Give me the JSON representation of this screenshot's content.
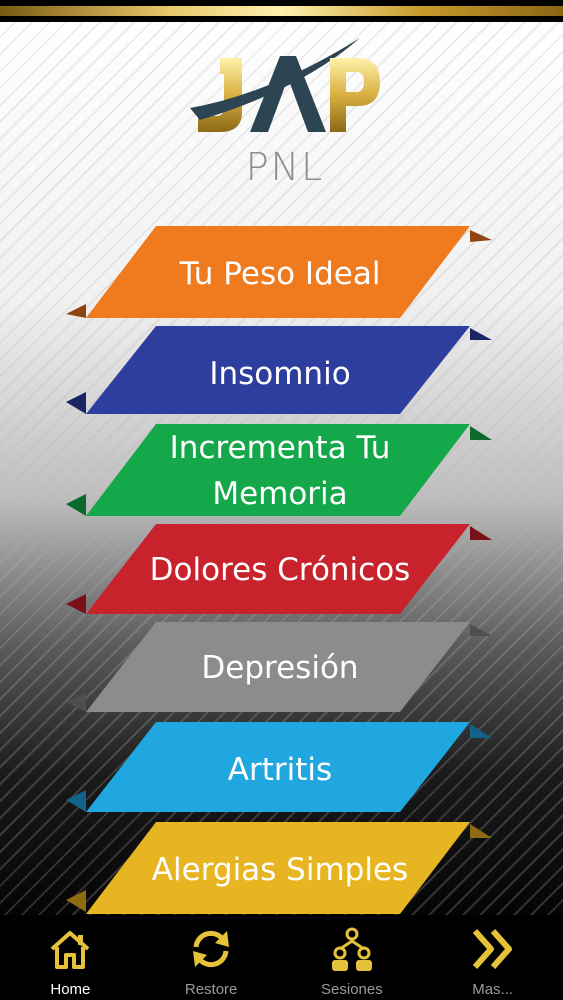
{
  "app": {
    "logo_text": "JAP",
    "logo_subtitle": "PNL"
  },
  "menu": [
    {
      "label": "Tu Peso Ideal",
      "color": "#f07a1e",
      "shadow": "#8e4512"
    },
    {
      "label": "Insomnio",
      "color": "#2e3e9e",
      "shadow": "#1b2566"
    },
    {
      "label": "Incrementa Tu Memoria",
      "line1": "Incrementa Tu",
      "line2": "Memoria",
      "color": "#15a84a",
      "shadow": "#0a6a2c"
    },
    {
      "label": "Dolores Crónicos",
      "color": "#c8222d",
      "shadow": "#7a1018"
    },
    {
      "label": "Depresión",
      "color": "#8c8c8e",
      "shadow": "#4e4e50"
    },
    {
      "label": "Artritis",
      "color": "#21a7e0",
      "shadow": "#12628a"
    },
    {
      "label": "Alergias Simples",
      "color": "#e8b522",
      "shadow": "#8e6a12"
    }
  ],
  "tabbar": {
    "accent": "#e6c23a",
    "tabs": [
      {
        "label": "Home",
        "icon": "home-icon",
        "active": true
      },
      {
        "label": "Restore",
        "icon": "refresh-icon",
        "active": false
      },
      {
        "label": "Sesiones",
        "icon": "group-icon",
        "active": false
      },
      {
        "label": "Mas...",
        "icon": "double-chevron-right-icon",
        "active": false
      }
    ]
  }
}
